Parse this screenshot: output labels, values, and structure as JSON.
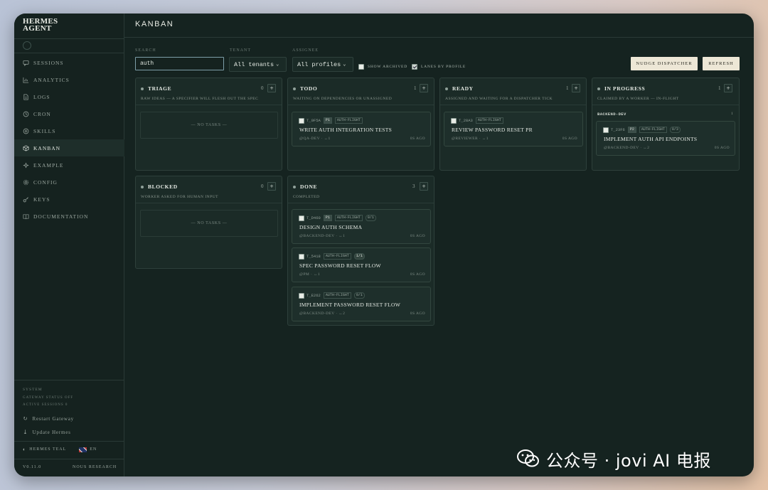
{
  "app": {
    "brand_line1": "HERMES",
    "brand_line2": "AGENT",
    "page_title": "KANBAN"
  },
  "sidebar": {
    "items": [
      {
        "label": "SESSIONS",
        "icon": "chat-icon"
      },
      {
        "label": "ANALYTICS",
        "icon": "chart-icon"
      },
      {
        "label": "LOGS",
        "icon": "file-icon"
      },
      {
        "label": "CRON",
        "icon": "clock-icon"
      },
      {
        "label": "SKILLS",
        "icon": "puzzle-icon"
      },
      {
        "label": "KANBAN",
        "icon": "cube-icon",
        "active": true
      },
      {
        "label": "EXAMPLE",
        "icon": "sparkle-icon"
      },
      {
        "label": "CONFIG",
        "icon": "gear-icon"
      },
      {
        "label": "KEYS",
        "icon": "key-icon"
      },
      {
        "label": "DOCUMENTATION",
        "icon": "book-icon"
      }
    ],
    "system_label": "SYSTEM",
    "system_line1": "GATEWAY STATUS OFF",
    "system_line2": "ACTIVE SESSIONS 0",
    "restart_label": "Restart Gateway",
    "update_label": "Update Hermes",
    "theme_label": "HERMES TEAL",
    "lang_label": "EN",
    "version": "V0.11.0",
    "vendor": "NOUS RESEARCH"
  },
  "filters": {
    "search_label": "SEARCH",
    "search_value": "auth",
    "tenant_label": "TENANT",
    "tenant_value": "All tenants",
    "assignee_label": "ASSIGNEE",
    "assignee_value": "All profiles",
    "show_archived_label": "SHOW ARCHIVED",
    "lanes_label": "LANES BY PROFILE",
    "nudge_label": "NUDGE DISPATCHER",
    "refresh_label": "REFRESH"
  },
  "columns": {
    "triage": {
      "title": "TRIAGE",
      "count": "0",
      "desc": "RAW IDEAS — A SPECIFIER WILL FLESH OUT THE SPEC",
      "empty": "— NO TASKS —"
    },
    "todo": {
      "title": "TODO",
      "count": "1",
      "desc": "WAITING ON DEPENDENCIES OR UNASSIGNED"
    },
    "ready": {
      "title": "READY",
      "count": "1",
      "desc": "ASSIGNED AND WAITING FOR A DISPATCHER TICK"
    },
    "in_progress": {
      "title": "IN PROGRESS",
      "count": "1",
      "desc": "CLAIMED BY A WORKER — IN-FLIGHT",
      "lane": "BACKEND-DEV",
      "lane_count": "1"
    },
    "blocked": {
      "title": "BLOCKED",
      "count": "0",
      "desc": "WORKER ASKED FOR HUMAN INPUT",
      "empty": "— NO TASKS —"
    },
    "done": {
      "title": "DONE",
      "count": "3",
      "desc": "COMPLETED"
    }
  },
  "cards": {
    "todo_1": {
      "id": "T_0F5A",
      "badge": "P1",
      "tag": "AUTH-FLIGHT",
      "title": "WRITE AUTH INTEGRATION TESTS",
      "meta": "@QA-DEV  ·  ↔1",
      "ago": "0S AGO"
    },
    "ready_1": {
      "id": "T_28A3",
      "tag": "AUTH-FLIGHT",
      "title": "REVIEW PASSWORD RESET PR",
      "meta": "@REVIEWER  ·  ↔1",
      "ago": "0S AGO"
    },
    "prog_1": {
      "id": "T_23F6",
      "badge": "P2",
      "tag": "AUTH-FLIGHT",
      "ratio": "0/3",
      "title": "IMPLEMENT AUTH API ENDPOINTS",
      "meta": "@BACKEND-DEV  ·  ↔2",
      "ago": "0S AGO"
    },
    "done_1": {
      "id": "T_D460",
      "badge": "P1",
      "tag": "AUTH-FLIGHT",
      "ratio": "0/1",
      "title": "DESIGN AUTH SCHEMA",
      "meta": "@BACKEND-DEV  ·  ↔1",
      "ago": "0S AGO"
    },
    "done_2": {
      "id": "T_5418",
      "tag": "AUTH-FLIGHT",
      "ratio": "1/1",
      "title": "SPEC PASSWORD RESET FLOW",
      "meta": "@PM  ·  ↔1",
      "ago": "0S AGO"
    },
    "done_3": {
      "id": "T_E262",
      "tag": "AUTH-FLIGHT",
      "ratio": "0/1",
      "title": "IMPLEMENT PASSWORD RESET FLOW",
      "meta": "@BACKEND-DEV  ·  ↔2",
      "ago": "0S AGO"
    }
  },
  "watermark": {
    "text": "公众号 · jovi AI 电报"
  }
}
